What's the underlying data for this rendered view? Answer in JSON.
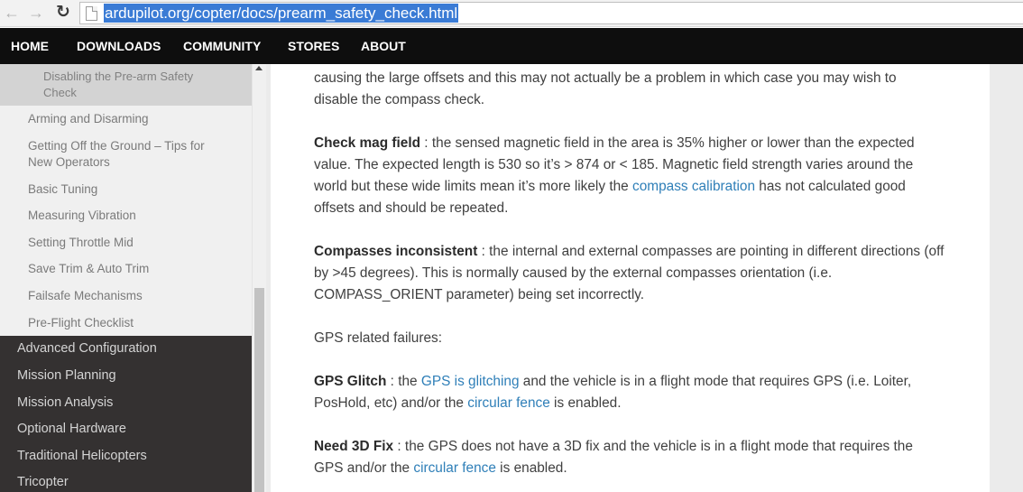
{
  "browser": {
    "url": "ardupilot.org/copter/docs/prearm_safety_check.html"
  },
  "site_nav": {
    "items": [
      "HOME",
      "DOWNLOADS",
      "COMMUNITY",
      "STORES",
      "ABOUT"
    ]
  },
  "sidebar": {
    "active_item": {
      "line1": "Disabling the Pre-arm Safety",
      "line2": "Check"
    },
    "items": [
      "Arming and Disarming",
      "Getting Off the Ground – Tips for",
      "New Operators",
      "Basic Tuning",
      "Measuring Vibration",
      "Setting Throttle Mid",
      "Save Trim & Auto Trim",
      "Failsafe Mechanisms",
      "Pre-Flight Checklist"
    ],
    "sections": [
      "Advanced Configuration",
      "Mission Planning",
      "Mission Analysis",
      "Optional Hardware",
      "Traditional Helicopters",
      "Tricopter"
    ]
  },
  "content": {
    "intro_line1": "causing the large offsets and this may not actually be a problem in which case you may wish to",
    "intro_line2": "disable the compass check.",
    "mag_field": {
      "term": "Check mag field",
      "text_a": " : the sensed magnetic field in the area is 35% higher or lower than the expected value. The expected length is 530 so it’s > 874 or < 185. Magnetic field strength varies around the world but these wide limits mean it’s more likely the ",
      "link": "compass calibration",
      "text_b": " has not calculated good offsets and should be repeated."
    },
    "compasses": {
      "term": "Compasses inconsistent",
      "text": " : the internal and external compasses are pointing in different directions (off by >45 degrees). This is normally caused by the external compasses orientation (i.e. COMPASS_ORIENT parameter) being set incorrectly."
    },
    "gps_heading": "GPS related failures:",
    "gps_glitch": {
      "term": "GPS Glitch",
      "text_a": " : the ",
      "link1": "GPS is glitching",
      "text_b": " and the vehicle is in a flight mode that requires GPS (i.e. Loiter, PosHold, etc) and/or the ",
      "link2": "circular fence",
      "text_c": " is enabled."
    },
    "need_3d_fix": {
      "term": "Need 3D Fix",
      "text_a": " : the GPS does not have a 3D fix and the vehicle is in a flight mode that requires the GPS and/or the ",
      "link": "circular fence",
      "text_b": " is enabled."
    }
  }
}
